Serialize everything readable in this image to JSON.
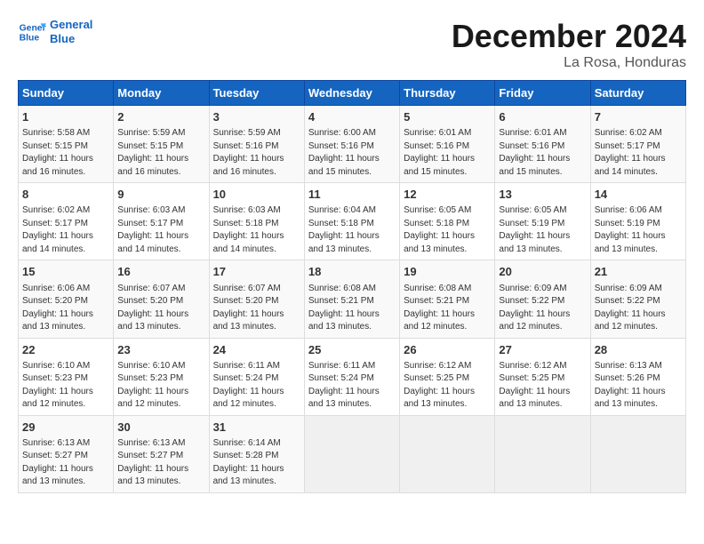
{
  "header": {
    "logo_line1": "General",
    "logo_line2": "Blue",
    "month_title": "December 2024",
    "location": "La Rosa, Honduras"
  },
  "days_of_week": [
    "Sunday",
    "Monday",
    "Tuesday",
    "Wednesday",
    "Thursday",
    "Friday",
    "Saturday"
  ],
  "weeks": [
    [
      {
        "day": "1",
        "info": "Sunrise: 5:58 AM\nSunset: 5:15 PM\nDaylight: 11 hours and 16 minutes."
      },
      {
        "day": "2",
        "info": "Sunrise: 5:59 AM\nSunset: 5:15 PM\nDaylight: 11 hours and 16 minutes."
      },
      {
        "day": "3",
        "info": "Sunrise: 5:59 AM\nSunset: 5:16 PM\nDaylight: 11 hours and 16 minutes."
      },
      {
        "day": "4",
        "info": "Sunrise: 6:00 AM\nSunset: 5:16 PM\nDaylight: 11 hours and 15 minutes."
      },
      {
        "day": "5",
        "info": "Sunrise: 6:01 AM\nSunset: 5:16 PM\nDaylight: 11 hours and 15 minutes."
      },
      {
        "day": "6",
        "info": "Sunrise: 6:01 AM\nSunset: 5:16 PM\nDaylight: 11 hours and 15 minutes."
      },
      {
        "day": "7",
        "info": "Sunrise: 6:02 AM\nSunset: 5:17 PM\nDaylight: 11 hours and 14 minutes."
      }
    ],
    [
      {
        "day": "8",
        "info": "Sunrise: 6:02 AM\nSunset: 5:17 PM\nDaylight: 11 hours and 14 minutes."
      },
      {
        "day": "9",
        "info": "Sunrise: 6:03 AM\nSunset: 5:17 PM\nDaylight: 11 hours and 14 minutes."
      },
      {
        "day": "10",
        "info": "Sunrise: 6:03 AM\nSunset: 5:18 PM\nDaylight: 11 hours and 14 minutes."
      },
      {
        "day": "11",
        "info": "Sunrise: 6:04 AM\nSunset: 5:18 PM\nDaylight: 11 hours and 13 minutes."
      },
      {
        "day": "12",
        "info": "Sunrise: 6:05 AM\nSunset: 5:18 PM\nDaylight: 11 hours and 13 minutes."
      },
      {
        "day": "13",
        "info": "Sunrise: 6:05 AM\nSunset: 5:19 PM\nDaylight: 11 hours and 13 minutes."
      },
      {
        "day": "14",
        "info": "Sunrise: 6:06 AM\nSunset: 5:19 PM\nDaylight: 11 hours and 13 minutes."
      }
    ],
    [
      {
        "day": "15",
        "info": "Sunrise: 6:06 AM\nSunset: 5:20 PM\nDaylight: 11 hours and 13 minutes."
      },
      {
        "day": "16",
        "info": "Sunrise: 6:07 AM\nSunset: 5:20 PM\nDaylight: 11 hours and 13 minutes."
      },
      {
        "day": "17",
        "info": "Sunrise: 6:07 AM\nSunset: 5:20 PM\nDaylight: 11 hours and 13 minutes."
      },
      {
        "day": "18",
        "info": "Sunrise: 6:08 AM\nSunset: 5:21 PM\nDaylight: 11 hours and 13 minutes."
      },
      {
        "day": "19",
        "info": "Sunrise: 6:08 AM\nSunset: 5:21 PM\nDaylight: 11 hours and 12 minutes."
      },
      {
        "day": "20",
        "info": "Sunrise: 6:09 AM\nSunset: 5:22 PM\nDaylight: 11 hours and 12 minutes."
      },
      {
        "day": "21",
        "info": "Sunrise: 6:09 AM\nSunset: 5:22 PM\nDaylight: 11 hours and 12 minutes."
      }
    ],
    [
      {
        "day": "22",
        "info": "Sunrise: 6:10 AM\nSunset: 5:23 PM\nDaylight: 11 hours and 12 minutes."
      },
      {
        "day": "23",
        "info": "Sunrise: 6:10 AM\nSunset: 5:23 PM\nDaylight: 11 hours and 12 minutes."
      },
      {
        "day": "24",
        "info": "Sunrise: 6:11 AM\nSunset: 5:24 PM\nDaylight: 11 hours and 12 minutes."
      },
      {
        "day": "25",
        "info": "Sunrise: 6:11 AM\nSunset: 5:24 PM\nDaylight: 11 hours and 13 minutes."
      },
      {
        "day": "26",
        "info": "Sunrise: 6:12 AM\nSunset: 5:25 PM\nDaylight: 11 hours and 13 minutes."
      },
      {
        "day": "27",
        "info": "Sunrise: 6:12 AM\nSunset: 5:25 PM\nDaylight: 11 hours and 13 minutes."
      },
      {
        "day": "28",
        "info": "Sunrise: 6:13 AM\nSunset: 5:26 PM\nDaylight: 11 hours and 13 minutes."
      }
    ],
    [
      {
        "day": "29",
        "info": "Sunrise: 6:13 AM\nSunset: 5:27 PM\nDaylight: 11 hours and 13 minutes."
      },
      {
        "day": "30",
        "info": "Sunrise: 6:13 AM\nSunset: 5:27 PM\nDaylight: 11 hours and 13 minutes."
      },
      {
        "day": "31",
        "info": "Sunrise: 6:14 AM\nSunset: 5:28 PM\nDaylight: 11 hours and 13 minutes."
      },
      {
        "day": "",
        "info": ""
      },
      {
        "day": "",
        "info": ""
      },
      {
        "day": "",
        "info": ""
      },
      {
        "day": "",
        "info": ""
      }
    ]
  ]
}
